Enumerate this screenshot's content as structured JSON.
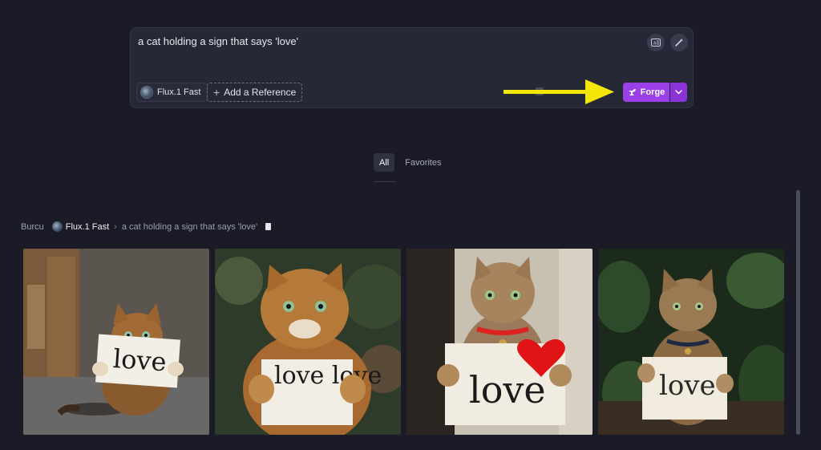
{
  "prompt": {
    "text": "a cat holding a sign that says 'love'",
    "model_label": "Flux.1 Fast",
    "reference_label": "Add a Reference",
    "forge_label": "Forge"
  },
  "filters": [
    {
      "label": "All",
      "active": true
    },
    {
      "label": "Favorites",
      "active": false
    }
  ],
  "generation": {
    "user": "Burcu",
    "model": "Flux.1 Fast",
    "separator": "›",
    "prompt": "a cat holding a sign that says 'love'"
  },
  "images": [
    {
      "sign_text": "love"
    },
    {
      "sign_text": "love love"
    },
    {
      "sign_text": "love"
    },
    {
      "sign_text": "love"
    }
  ],
  "colors": {
    "background": "#1a1b26",
    "panel": "#272836",
    "accent": "#9b3fe8",
    "annotation_arrow": "#f5e60a"
  },
  "icons": [
    "translate-icon",
    "magic-wand-icon",
    "forge-icon",
    "chevron-down-icon",
    "clipboard-icon",
    "plus-icon"
  ]
}
